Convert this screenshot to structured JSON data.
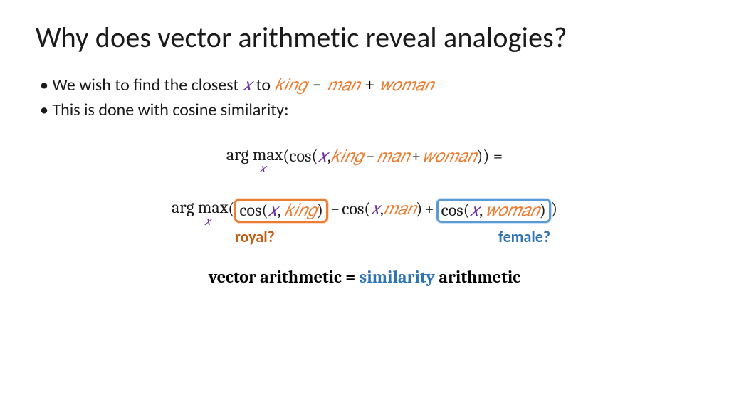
{
  "title": "Why does vector arithmetic reveal analogies?",
  "bullets": {
    "b1_prefix": "We wish to find the closest ",
    "b1_x": "𝑥",
    "b1_to": " to ",
    "b1_king": "𝑘𝑖𝑛𝑔",
    "b1_minus": " − ",
    "b1_man": "𝑚𝑎𝑛",
    "b1_plus": " + ",
    "b1_woman": "𝑤𝑜𝑚𝑎𝑛",
    "b2": "This is done with cosine similarity:"
  },
  "eq1": {
    "argmax": "arg max",
    "sub_x": "𝑥",
    "open": "(cos(",
    "x": "𝑥",
    "comma": ", ",
    "king": "𝑘𝑖𝑛𝑔",
    "minus": " − ",
    "man": "𝑚𝑎𝑛",
    "plus": " + ",
    "woman": "𝑤𝑜𝑚𝑎𝑛",
    "close": ")) ="
  },
  "eq2": {
    "argmax": "arg max",
    "sub_x": "𝑥",
    "open": "(",
    "cos1_l": "cos(",
    "x1": "𝑥",
    "comma1": ", ",
    "king": "𝑘𝑖𝑛𝑔",
    "cos1_r": ")",
    "minus": " − ",
    "cos2_l": "cos(",
    "x2": "𝑥",
    "comma2": ", ",
    "man": "𝑚𝑎𝑛",
    "cos2_r": ")",
    "plus": " + ",
    "cos3_l": "cos(",
    "x3": "𝑥",
    "comma3": ", ",
    "woman": "𝑤𝑜𝑚𝑎𝑛",
    "cos3_r": ")",
    "close": ")"
  },
  "captions": {
    "royal": "royal?",
    "female": "female?"
  },
  "footer": {
    "left": "vector arithmetic ",
    "eq": "=",
    "mid": " ",
    "similarity": "similarity",
    "right": " arithmetic"
  }
}
